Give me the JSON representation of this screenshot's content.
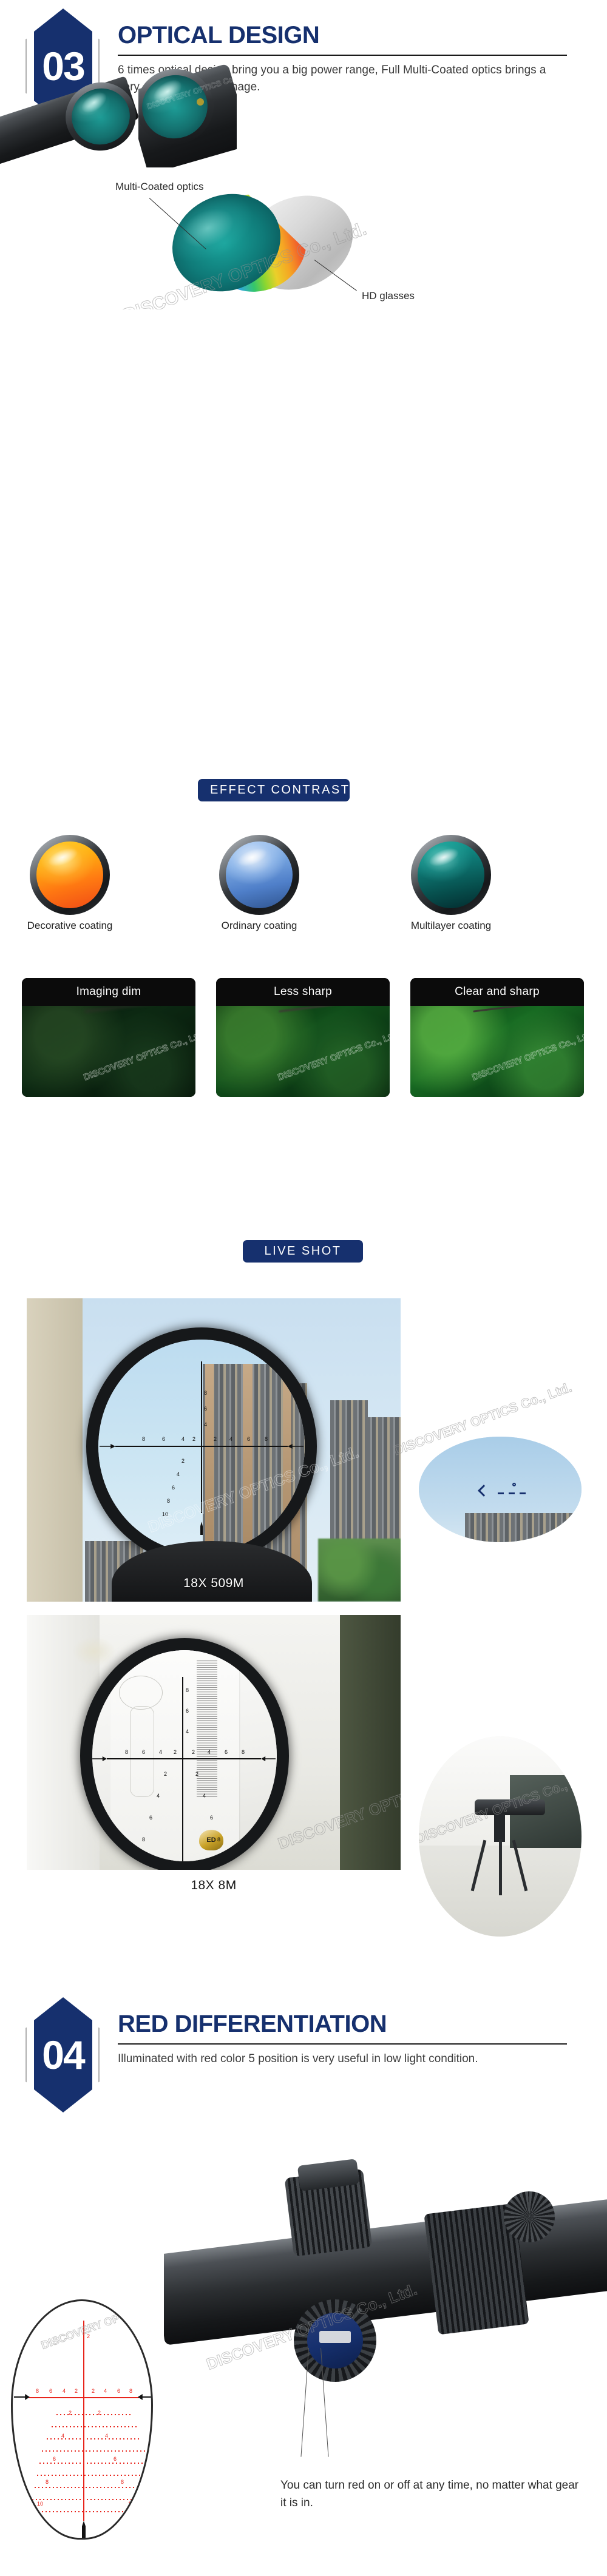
{
  "sections": [
    {
      "number": "03",
      "title": "OPTICAL DESIGN",
      "body": "6 times optical design bring you a big power range, Full Multi-Coated optics brings a very clear and sharp image."
    },
    {
      "number": "04",
      "title": "RED DIFFERENTIATION",
      "body": "Illuminated with red color 5 position is very useful in low light condition."
    }
  ],
  "lens_diagram": {
    "callout_top": "Multi-Coated optics",
    "callout_bottom": "HD glasses"
  },
  "banners": {
    "effect_contrast": "EFFECT CONTRAST",
    "live_shot": "LIVE SHOT"
  },
  "coatings": [
    {
      "label": "Decorative coating",
      "caption": "Imaging dim",
      "color": "#ff8a14"
    },
    {
      "label": "Ordinary coating",
      "caption": "Less sharp",
      "color": "#5a8ed1"
    },
    {
      "label": "Multilayer coating",
      "caption": "Clear and sharp",
      "color": "#11867f"
    }
  ],
  "live_shots": [
    {
      "caption": "18X 509M"
    },
    {
      "caption": "18X 8M"
    }
  ],
  "reticle": {
    "horizontal_ticks": [
      "8",
      "6",
      "4",
      "2",
      "2",
      "4",
      "6",
      "8"
    ],
    "vertical_ticks": [
      "2",
      "4",
      "6",
      "8",
      "10"
    ],
    "upper_ticks": [
      "2",
      "4",
      "6",
      "8"
    ]
  },
  "closing_note": "You can turn red on or off at any time, no matter what gear it is in.",
  "watermark": "DISCOVERY OPTICS Co., Ltd.",
  "colors": {
    "brand_navy": "#16306e",
    "reticle_red": "#e8251c",
    "lens_teal": "#11867f"
  }
}
